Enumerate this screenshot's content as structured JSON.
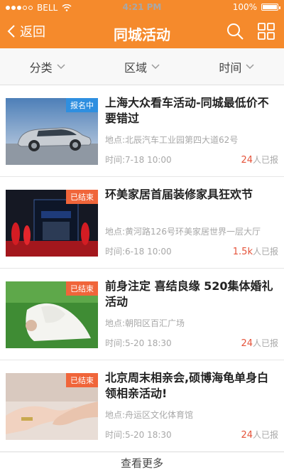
{
  "status": {
    "carrier": "BELL",
    "time": "4:21 PM",
    "battery": "100%"
  },
  "nav": {
    "back_label": "返回",
    "title": "同城活动"
  },
  "filters": [
    {
      "label": "分类"
    },
    {
      "label": "区域"
    },
    {
      "label": "时间"
    }
  ],
  "items": [
    {
      "tag": "报名中",
      "title": "上海大众看车活动-同城最低价不要错过",
      "address": "地点:北辰汽车工业园第四大道62号",
      "time": "时间:7-18  10:00",
      "count_num": "24",
      "count_suffix": "人已报"
    },
    {
      "tag": "已结束",
      "title": "环美家居首届装修家具狂欢节",
      "address": "地点:黄河路126号环美家居世界一层大厅",
      "time": "时间:6-18  10:00",
      "count_num": "1.5k",
      "count_suffix": "人已报"
    },
    {
      "tag": "已结束",
      "title": "前身注定  喜结良缘  520集体婚礼活动",
      "address": "地点:朝阳区百汇广场",
      "time": "时间:5-20  18:30",
      "count_num": "24",
      "count_suffix": "人已报"
    },
    {
      "tag": "已结束",
      "title": "北京周末相亲会,硕博海龟单身白领相亲活动!",
      "address": "地点:舟运区文化体育馆",
      "time": "时间:5-20  18:30",
      "count_num": "24",
      "count_suffix": "人已报"
    }
  ],
  "more_label": "查看更多",
  "colors": {
    "brand": "#f58a2c",
    "ongoing": "#2f8fe0",
    "ended": "#f0653a",
    "count": "#e5533a"
  }
}
